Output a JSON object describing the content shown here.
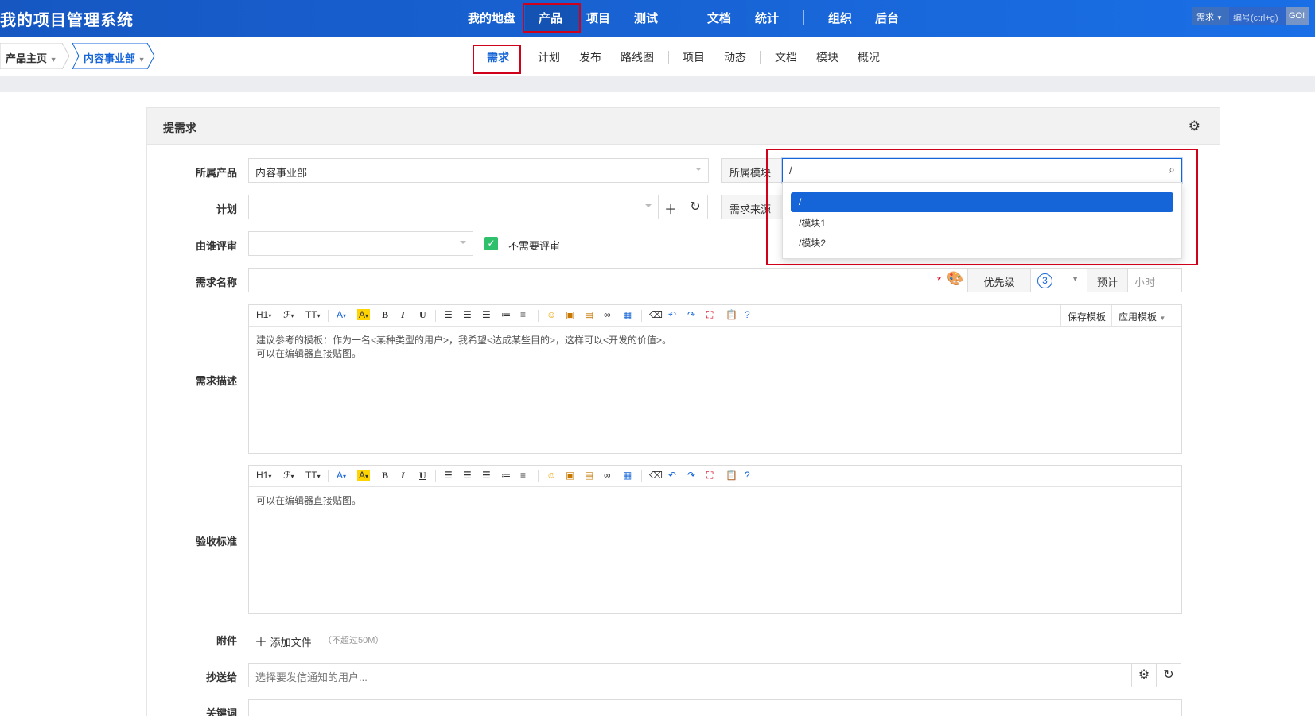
{
  "app": {
    "title": "我的项目管理系统"
  },
  "main_nav": [
    "我的地盘",
    "产品",
    "项目",
    "测试",
    "文档",
    "统计",
    "组织",
    "后台"
  ],
  "search": {
    "type_label": "需求",
    "placeholder": "编号(ctrl+g)",
    "go_label": "GO!"
  },
  "breadcrumb": {
    "home": "产品主页",
    "product": "内容事业部"
  },
  "sub_nav": [
    "需求",
    "计划",
    "发布",
    "路线图",
    "项目",
    "动态",
    "文档",
    "模块",
    "概况"
  ],
  "panel": {
    "title": "提需求"
  },
  "form": {
    "product_label": "所属产品",
    "product_value": "内容事业部",
    "module_label": "所属模块",
    "module_value": "/",
    "module_options": [
      "/",
      "/模块1",
      "/模块2"
    ],
    "plan_label": "计划",
    "source_label": "需求来源",
    "reviewer_label": "由谁评审",
    "no_review_label": "不需要评审",
    "name_label": "需求名称",
    "required_mark": "*",
    "priority_label": "优先级",
    "priority_value": "3",
    "estimate_label": "预计",
    "estimate_unit": "小时",
    "desc_label": "需求描述",
    "desc_text_line1": "建议参考的模板：作为一名<某种类型的用户>，我希望<达成某些目的>，这样可以<开发的价值>。",
    "desc_text_line2": "可以在编辑器直接贴图。",
    "save_template": "保存模板",
    "apply_template": "应用模板",
    "verify_label": "验收标准",
    "verify_text": "可以在编辑器直接贴图。",
    "attach_label": "附件",
    "add_file": "添加文件",
    "file_limit": "（不超过50M）",
    "cc_label": "抄送给",
    "cc_placeholder": "选择要发信通知的用户...",
    "keywords_label": "关键词"
  },
  "toolbar": [
    "H1",
    "ℱ",
    "TT",
    "A",
    "A",
    "B",
    "I",
    "U"
  ],
  "colors": {
    "topbar": "#1a6fe6",
    "accent": "#1565d8",
    "highlight_box": "#d0021b",
    "check": "#2fc06b"
  }
}
